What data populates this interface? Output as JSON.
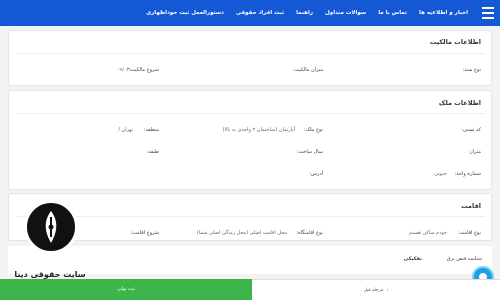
{
  "nav": {
    "items": [
      "دستورالعمل ثبت خوداظهاری",
      "ثبت افراد حقوقی",
      "راهنما",
      "سوالات متداول",
      "تماس با ما",
      "اخبار و اطلاعیه ها"
    ]
  },
  "ownership": {
    "title": "اطلاعات مالکیت",
    "doc_type_label": "نوع سند:",
    "share_label": "میزان مالکیت:",
    "start_label": "شروع مالکیت:",
    "start_value": "-۰۹/۰۳"
  },
  "property": {
    "title": "اطلاعات ملک",
    "postal_code_label": "کد پستی:",
    "prop_type_label": "نوع ملک:",
    "prop_type_value": "آپارتمان (ساختمان ۲ واحدی به بالا)",
    "region_label": "منطقه:",
    "region_value": "تهران /",
    "floor_label": "متراژ:",
    "build_year_label": "سال ساخت:",
    "floor_level_label": "طبقه:",
    "unit_no_label": "شماره واحد:",
    "unit_no_value": "جنوبی",
    "address_label": "آدرس:"
  },
  "residence": {
    "title": "اقامت",
    "res_type_label": "نوع اقامت:",
    "res_type_value": "خودم ساکن هستم",
    "res_place_label": "نوع اقامتگاه:",
    "res_place_value": "محل اقامت اصلی (محل زندگی اصلی شما)",
    "res_start_label": "شروع اقامت:"
  },
  "extra": {
    "meter_label": "شناسه قبض برق",
    "meter_value": "تفکیکی"
  },
  "footer": {
    "prev_label": "مرحله قبل",
    "next_label": "ثبت نهایی"
  },
  "logo": {
    "text": "سایت حقوقی دینا"
  }
}
